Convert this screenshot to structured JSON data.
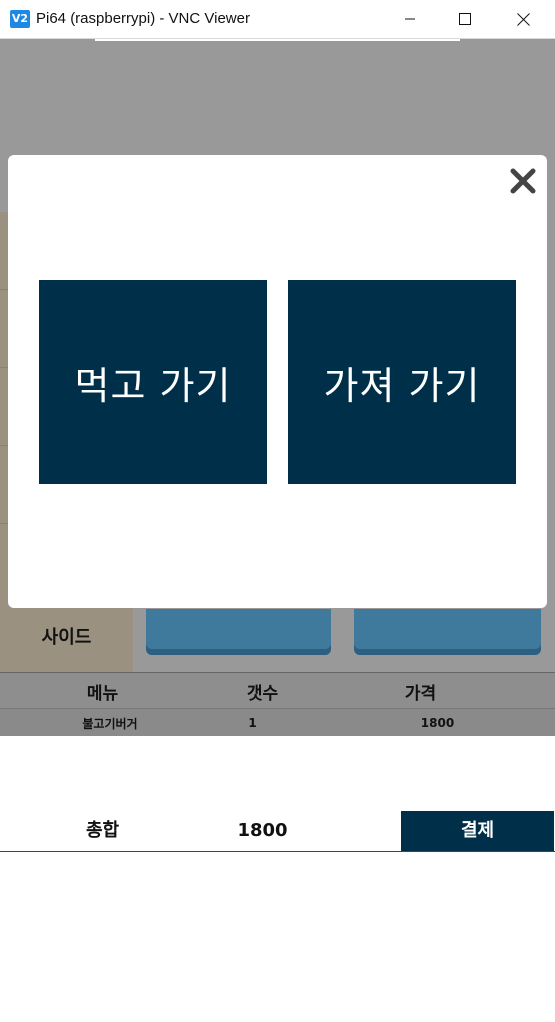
{
  "window": {
    "title": "Pi64 (raspberrypi) - VNC Viewer",
    "app_icon_text": "V2",
    "controls": [
      "minimize-icon",
      "maximize-icon",
      "close-icon"
    ]
  },
  "modal": {
    "close_icon": "close-x-icon",
    "options": [
      {
        "label": "먹고 가기"
      },
      {
        "label": "가져 가기"
      }
    ]
  },
  "sidebar": {
    "active_label": "사이드"
  },
  "order_table": {
    "headers": [
      "메뉴",
      "갯수",
      "가격"
    ],
    "rows": [
      {
        "menu": "불고기버거",
        "qty": "1",
        "price": "1800"
      }
    ]
  },
  "summary": {
    "total_label": "총합",
    "total_value": "1800",
    "pay_label": "결제"
  },
  "colors": {
    "primary": "#003049",
    "overlay": "#999999",
    "tile": "#3f7a9c"
  }
}
